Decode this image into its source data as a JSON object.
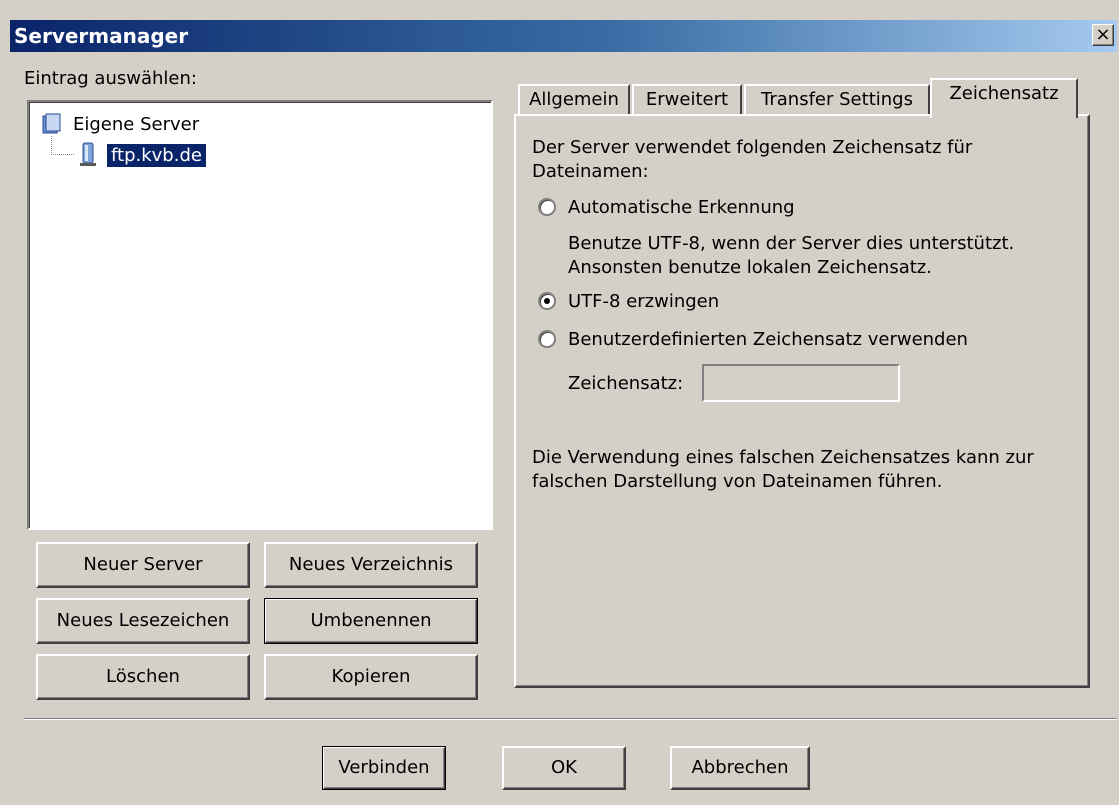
{
  "window": {
    "title": "Servermanager",
    "close_label": "×"
  },
  "left": {
    "label": "Eintrag auswählen:",
    "tree": {
      "root": "Eigene Server",
      "child": "ftp.kvb.de"
    },
    "buttons": {
      "new_server": "Neuer Server",
      "new_folder": "Neues Verzeichnis",
      "new_bookmark": "Neues Lesezeichen",
      "rename": "Umbenennen",
      "delete": "Löschen",
      "copy": "Kopieren"
    }
  },
  "tabs": [
    "Allgemein",
    "Erweitert",
    "Transfer Settings",
    "Zeichensatz"
  ],
  "charset": {
    "intro": "Der Server verwendet folgenden Zeichensatz für Dateinamen:",
    "auto_label": "Automatische Erkennung",
    "auto_desc_1": "Benutze UTF-8, wenn der Server dies unterstützt.",
    "auto_desc_2": "Ansonsten benutze lokalen Zeichensatz.",
    "utf8_label": "UTF-8 erzwingen",
    "custom_label": "Benutzerdefinierten Zeichensatz verwenden",
    "field_label": "Zeichensatz:",
    "field_value": "",
    "warning_1": "Die Verwendung eines falschen Zeichensatzes kann zur",
    "warning_2": "falschen Darstellung von Dateinamen führen.",
    "selected": "utf8"
  },
  "footer": {
    "connect": "Verbinden",
    "ok": "OK",
    "cancel": "Abbrechen"
  }
}
